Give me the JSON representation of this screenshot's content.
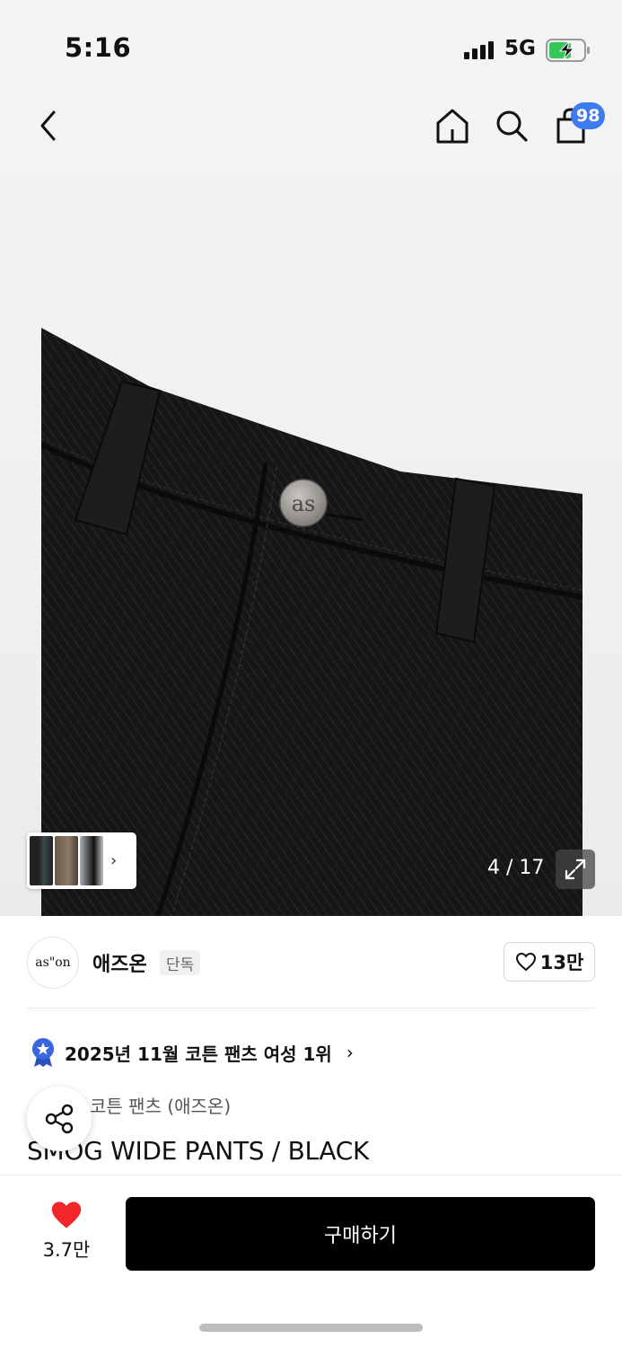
{
  "status_bar": {
    "time": "5:16",
    "network": "5G",
    "battery_state": "charging",
    "battery_color": "#34c759"
  },
  "nav": {
    "back_icon": "chevron-left-icon",
    "home_icon": "home-icon",
    "search_icon": "search-icon",
    "cart_icon": "shopping-bag-icon",
    "cart_badge": "98",
    "badge_color": "#3d7cf0"
  },
  "gallery": {
    "page_counter": "4 / 17",
    "current_page": 4,
    "total_pages": 17,
    "expand_icon": "expand-icon",
    "button_engraving": "as"
  },
  "store": {
    "logo_text": "as\"on",
    "name": "애즈온",
    "tag": "단독",
    "like_count": "13만"
  },
  "ranking": {
    "text": "2025년 11월 코튼 팬츠 여성 1위",
    "badge_icon": "ranking-medal-icon"
  },
  "product": {
    "category": "코튼 팬츠 (애즈온)",
    "title": "SMOG WIDE PANTS / BLACK"
  },
  "bottom_bar": {
    "wish_count": "3.7만",
    "wish_color": "#f0262a",
    "buy_label": "구매하기"
  }
}
